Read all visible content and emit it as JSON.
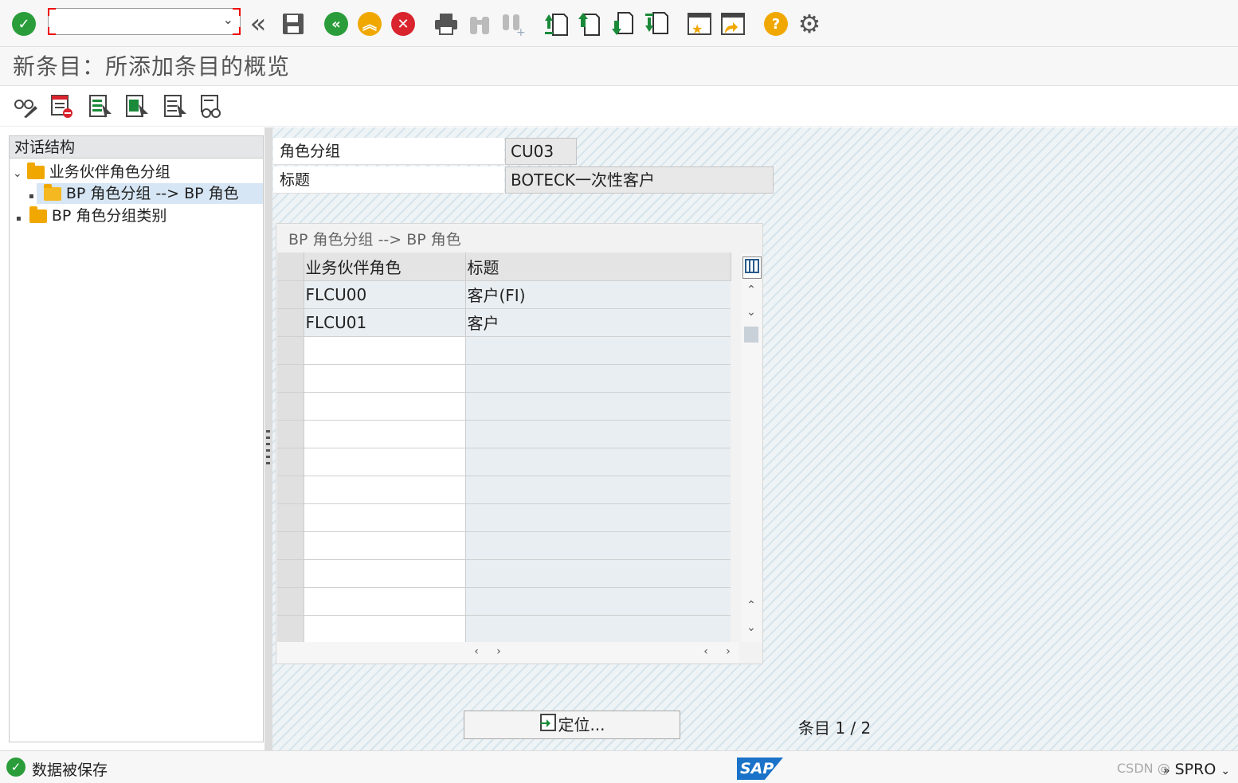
{
  "toolbar": {
    "command_field_value": "",
    "icons": [
      "enter-icon",
      "command-field",
      "back-double-icon",
      "save-icon",
      "back-icon",
      "exit-icon",
      "cancel-icon",
      "print-icon",
      "find-icon",
      "find-next-icon",
      "first-page-icon",
      "previous-page-icon",
      "next-page-icon",
      "last-page-icon",
      "create-session-icon",
      "shortcut-icon",
      "help-icon",
      "settings-icon"
    ]
  },
  "title": "新条目：所添加条目的概览",
  "app_toolbar": {
    "icons": [
      "change-display-icon",
      "delete-icon",
      "select-all-icon",
      "select-block-icon",
      "deselect-all-icon",
      "print-view-icon"
    ]
  },
  "tree": {
    "header": "对话结构",
    "nodes": [
      {
        "label": "业务伙伴角色分组",
        "expanded": true
      },
      {
        "label": "BP 角色分组 --> BP 角色",
        "selected": true
      },
      {
        "label": "BP 角色分组类别"
      }
    ]
  },
  "fields": {
    "group_label": "角色分组",
    "group_value": "CU03",
    "title_label": "标题",
    "title_value": "BOTECK一次性客户"
  },
  "table": {
    "group_title": "BP 角色分组 --> BP 角色",
    "col1_header": "业务伙伴角色",
    "col2_header": "标题",
    "rows": [
      {
        "role": "FLCU00",
        "title": "客户(FI)"
      },
      {
        "role": "FLCU01",
        "title": "客户"
      }
    ]
  },
  "bottom": {
    "position_button": "定位...",
    "entries_label": "条目",
    "entries_value": "1 / 2"
  },
  "status": {
    "message": "数据被保存",
    "transaction": "SPRO",
    "logo": "SAP",
    "watermark": "CSDN @"
  }
}
